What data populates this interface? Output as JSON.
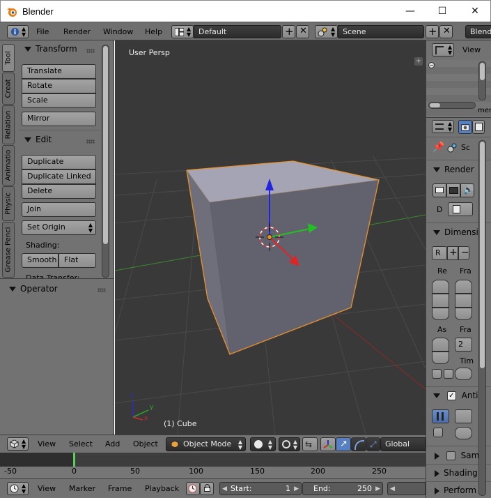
{
  "window": {
    "title": "Blender",
    "minimize_glyph": "—",
    "maximize_glyph": "☐",
    "close_glyph": "✕"
  },
  "info_header": {
    "menus": [
      "File",
      "Render",
      "Window",
      "Help"
    ],
    "screen_layout": "Default",
    "scene": "Scene",
    "render_engine": "Blend"
  },
  "tool_tabs": [
    "Tool",
    "Creat",
    "Relation",
    "Animatio",
    "Physic",
    "Grease Penci"
  ],
  "toolshelf": {
    "transform_title": "Transform",
    "transform_buttons": [
      "Translate",
      "Rotate",
      "Scale"
    ],
    "mirror_label": "Mirror",
    "edit_title": "Edit",
    "edit_buttons": [
      "Duplicate",
      "Duplicate Linked",
      "Delete"
    ],
    "join_label": "Join",
    "set_origin_label": "Set Origin",
    "shading_label": "Shading:",
    "smooth_label": "Smooth",
    "flat_label": "Flat",
    "data_transfer_label": "Data Transfer:",
    "operator_title": "Operator"
  },
  "viewport": {
    "view_label": "User Persp",
    "object_label": "(1) Cube",
    "axis_x": "x",
    "axis_y": "y",
    "axis_z": "z",
    "plus_glyph": "+"
  },
  "view3d_header": {
    "menus": [
      "View",
      "Select",
      "Add",
      "Object"
    ],
    "mode": "Object Mode",
    "transform_orientation": "Global"
  },
  "timeline": {
    "ticks": [
      "-50",
      "0",
      "50",
      "100",
      "150",
      "200",
      "250"
    ],
    "current_frame": 0,
    "menus": [
      "View",
      "Marker",
      "Frame",
      "Playback"
    ],
    "start_label": "Start:",
    "start_value": "1",
    "end_label": "End:",
    "end_value": "250"
  },
  "outliner": {
    "view_label": "View",
    "partial_item": "mer"
  },
  "properties": {
    "scene_label": "Sc",
    "render_title": "Render",
    "display_label": "D",
    "dimensions_title": "Dimensi",
    "resolution_label": "R",
    "col_re": "Re",
    "col_fra": "Fra",
    "col_as": "As",
    "col_fra2": "Fra",
    "frame_rate": "2",
    "time_label": "Tim",
    "aa_title": "Anti-",
    "sampling_title": "Sam",
    "shading_title": "Shading",
    "performance_title": "Perform"
  }
}
